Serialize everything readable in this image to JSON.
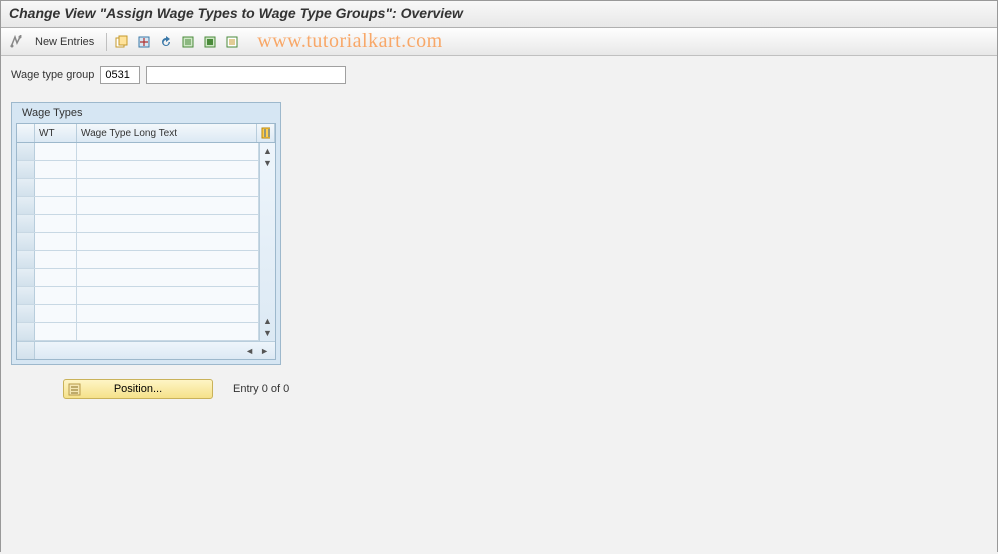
{
  "title": "Change View \"Assign Wage Types to Wage Type Groups\": Overview",
  "toolbar": {
    "new_entries_label": "New Entries"
  },
  "watermark": "www.tutorialkart.com",
  "form": {
    "wage_type_group_label": "Wage type group",
    "wage_type_group_value": "0531",
    "wage_type_group_desc": ""
  },
  "grid": {
    "panel_title": "Wage Types",
    "columns": {
      "wt": "WT",
      "long_text": "Wage Type Long Text"
    },
    "rows": [
      {
        "wt": "",
        "long_text": ""
      },
      {
        "wt": "",
        "long_text": ""
      },
      {
        "wt": "",
        "long_text": ""
      },
      {
        "wt": "",
        "long_text": ""
      },
      {
        "wt": "",
        "long_text": ""
      },
      {
        "wt": "",
        "long_text": ""
      },
      {
        "wt": "",
        "long_text": ""
      },
      {
        "wt": "",
        "long_text": ""
      },
      {
        "wt": "",
        "long_text": ""
      },
      {
        "wt": "",
        "long_text": ""
      },
      {
        "wt": "",
        "long_text": ""
      }
    ]
  },
  "footer": {
    "position_label": "Position...",
    "entry_text": "Entry 0 of 0"
  }
}
